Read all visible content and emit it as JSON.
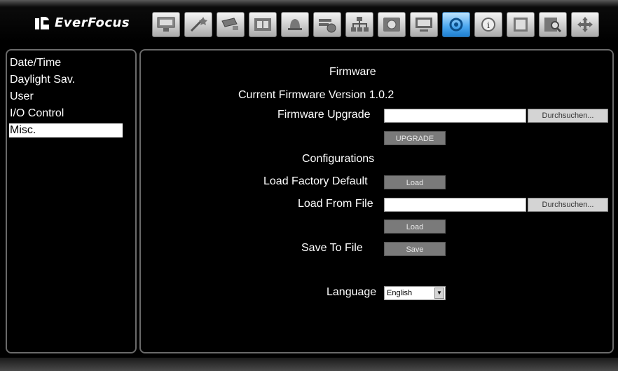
{
  "brand": {
    "name": "EverFocus"
  },
  "toolbar": {
    "icons": [
      "display-icon",
      "wizard-icon",
      "camera-icon",
      "film-icon",
      "alarm-bell-icon",
      "record-timer-icon",
      "network-icon",
      "disk-icon",
      "monitor-icon",
      "system-settings-icon",
      "info-icon",
      "event-log-icon",
      "search-icon",
      "move-icon"
    ],
    "active": "system-settings-icon"
  },
  "sidebar": {
    "items": [
      {
        "label": "Date/Time"
      },
      {
        "label": "Daylight Sav."
      },
      {
        "label": "User"
      },
      {
        "label": "I/O Control"
      },
      {
        "label": "Misc."
      }
    ],
    "selected": "Misc."
  },
  "main": {
    "firmware_heading": "Firmware",
    "current_version_label": "Current Firmware Version",
    "current_version_value": "1.0.2",
    "firmware_upgrade_label": "Firmware Upgrade",
    "firmware_upgrade_value": "",
    "browse_label": "Durchsuchen...",
    "upgrade_button": "UPGRADE",
    "configurations_heading": "Configurations",
    "load_factory_label": "Load Factory Default",
    "load_button": "Load",
    "load_from_file_label": "Load From File",
    "load_from_file_value": "",
    "browse_label_2": "Durchsuchen...",
    "load_button_2": "Load",
    "save_to_file_label": "Save To File",
    "save_button": "Save",
    "language_label": "Language",
    "language_value": "English"
  },
  "colors": {
    "accent": "#1e7fd0",
    "background": "#000000",
    "button": "#7a7a7a"
  }
}
